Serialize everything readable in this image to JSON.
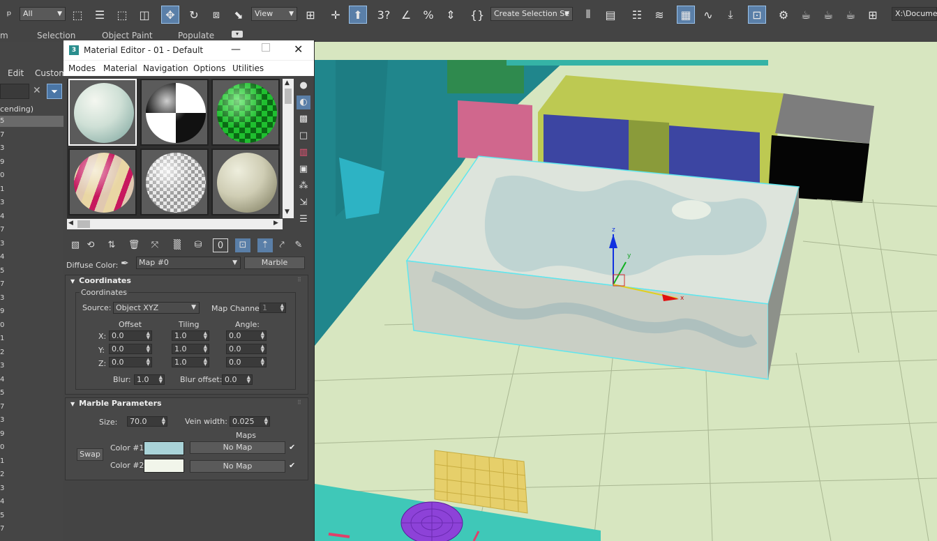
{
  "toolbar": {
    "selection_filter": "All",
    "ref_coord": "View",
    "selection_set": "Create Selection Se",
    "project_path": "X:\\Documen",
    "snap_3": "3"
  },
  "ribbon": {
    "tab_m": "m",
    "tab_selection": "Selection",
    "tab_object_paint": "Object Paint",
    "tab_populate": "Populate"
  },
  "scene_explorer": {
    "menu_edit": "Edit",
    "menu_custom": "Custom",
    "sort_label": "cending)",
    "rows": [
      "5",
      "7",
      "3",
      "9",
      "0",
      "1",
      "3",
      "4",
      "7",
      "3",
      "4",
      "5",
      "7",
      "3",
      "9",
      "0",
      "1",
      "2",
      "3",
      "4",
      "5",
      "7",
      "3",
      "9",
      "0",
      "1",
      "2",
      "3",
      "4",
      "5",
      "7"
    ]
  },
  "material_editor": {
    "title": "Material Editor - 01 - Default",
    "menu": [
      "Modes",
      "Material",
      "Navigation",
      "Options",
      "Utilities"
    ],
    "diffuse_label": "Diffuse Color:",
    "map_name": "Map #0",
    "map_type": "Marble",
    "coordinates": {
      "rollout_title": "Coordinates",
      "group_title": "Coordinates",
      "source_label": "Source:",
      "source_value": "Object XYZ",
      "map_channel_label": "Map Channel:",
      "map_channel_value": "1",
      "offset_label": "Offset",
      "tiling_label": "Tiling",
      "angle_label": "Angle:",
      "x_label": "X:",
      "y_label": "Y:",
      "z_label": "Z:",
      "offset": [
        "0.0",
        "0.0",
        "0.0"
      ],
      "tiling": [
        "1.0",
        "1.0",
        "1.0"
      ],
      "angle": [
        "0.0",
        "0.0",
        "0.0"
      ],
      "blur_label": "Blur:",
      "blur_value": "1.0",
      "blur_offset_label": "Blur offset:",
      "blur_offset_value": "0.0"
    },
    "marble": {
      "rollout_title": "Marble Parameters",
      "size_label": "Size:",
      "size_value": "70.0",
      "vein_label": "Vein width:",
      "vein_value": "0.025",
      "maps_label": "Maps",
      "swap_label": "Swap",
      "color1_label": "Color #1",
      "color2_label": "Color #2",
      "color1": "#a9d3d8",
      "color2": "#f1f5ea",
      "map1": "No Map",
      "map2": "No Map"
    },
    "x_icon": "✕"
  },
  "viewport": {
    "axis_x": "x",
    "axis_y": "y",
    "axis_z": "z"
  }
}
